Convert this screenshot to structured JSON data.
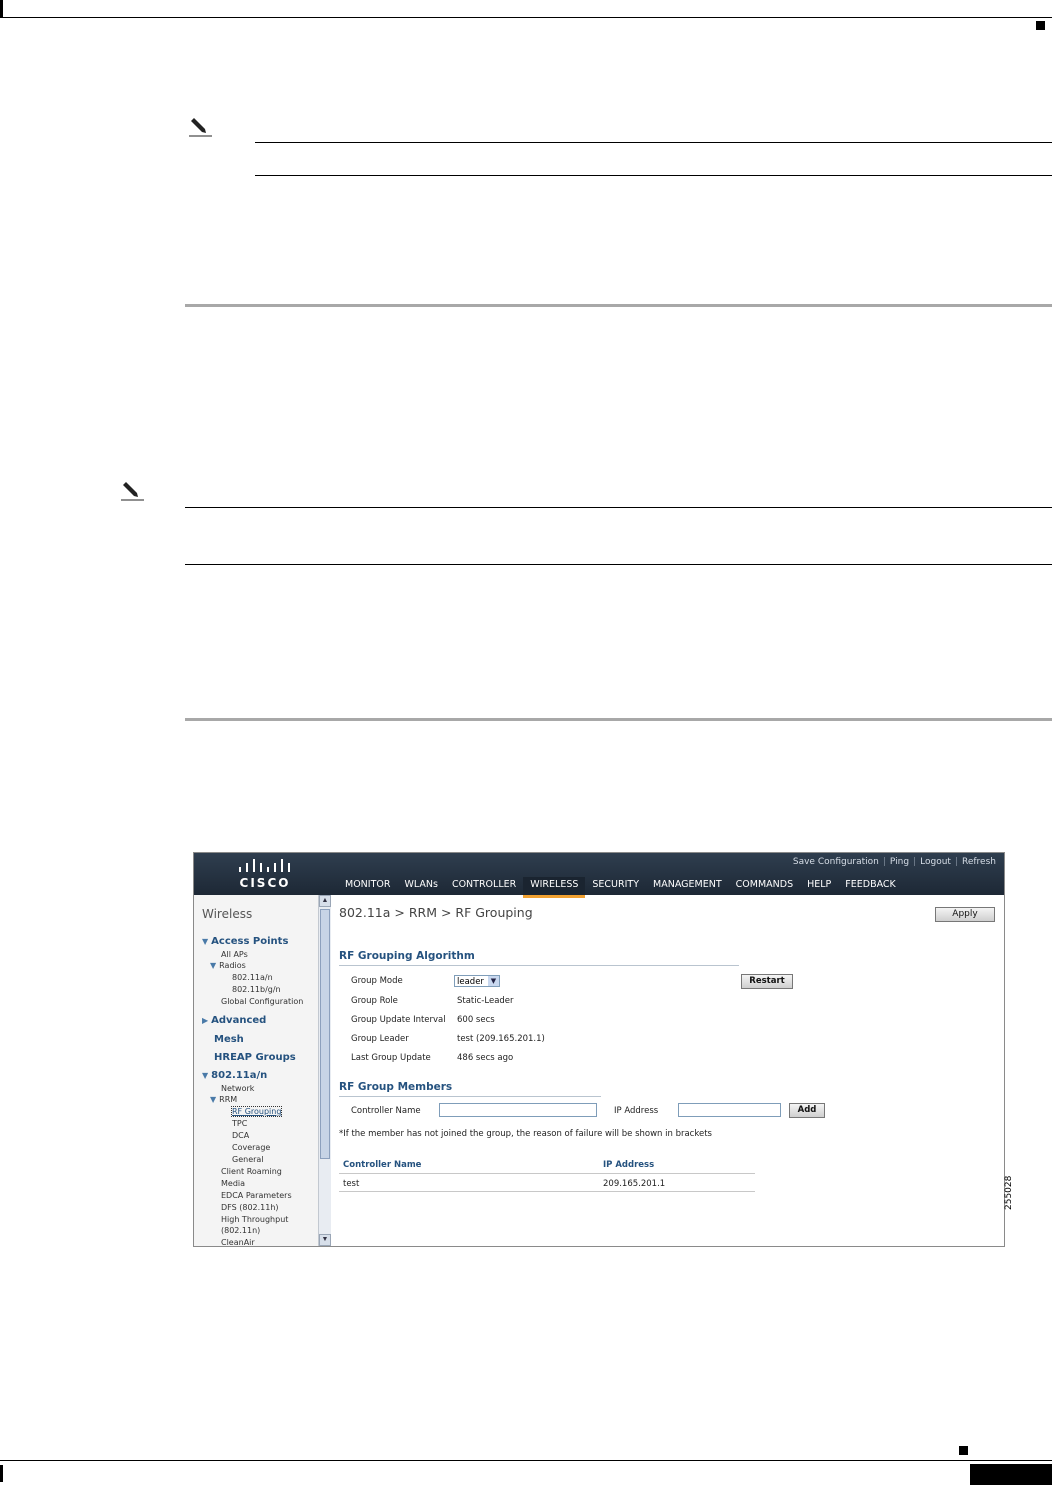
{
  "figure_id": "255028",
  "screenshot": {
    "utility_links": [
      "Save Configuration",
      "Ping",
      "Logout",
      "Refresh"
    ],
    "logo_text": "CISCO",
    "nav": [
      "MONITOR",
      "WLANs",
      "CONTROLLER",
      "WIRELESS",
      "SECURITY",
      "MANAGEMENT",
      "COMMANDS",
      "HELP",
      "FEEDBACK"
    ],
    "active_nav": "WIRELESS",
    "sidebar": {
      "title": "Wireless",
      "access_points": "Access Points",
      "all_aps": "All APs",
      "radios": "Radios",
      "radio_a": "802.11a/n",
      "radio_bg": "802.11b/g/n",
      "global_config": "Global Configuration",
      "advanced": "Advanced",
      "mesh": "Mesh",
      "hreap": "HREAP Groups",
      "band": "802.11a/n",
      "network": "Network",
      "rrm": "RRM",
      "rf_grouping": "RF Grouping",
      "tpc": "TPC",
      "dca": "DCA",
      "coverage": "Coverage",
      "general": "General",
      "client_roaming": "Client Roaming",
      "media": "Media",
      "edca": "EDCA Parameters",
      "dfs": "DFS (802.11h)",
      "high_throughput": "High Throughput",
      "high_throughput_2": "(802.11n)",
      "cleanair": "CleanAir"
    },
    "breadcrumb": "802.11a > RRM > RF Grouping",
    "apply_label": "Apply",
    "algorithm": {
      "title": "RF Grouping Algorithm",
      "group_mode_label": "Group Mode",
      "group_mode_value": "leader",
      "restart_label": "Restart",
      "group_role_label": "Group Role",
      "group_role_value": "Static-Leader",
      "update_interval_label": "Group Update Interval",
      "update_interval_value": "600 secs",
      "group_leader_label": "Group Leader",
      "group_leader_value": "test (209.165.201.1)",
      "last_update_label": "Last Group Update",
      "last_update_value": "486 secs ago"
    },
    "members": {
      "title": "RF Group Members",
      "controller_name_label": "Controller Name",
      "ip_address_label": "IP Address",
      "add_label": "Add",
      "note": "*If the member has not joined the group, the reason of failure will be shown in brackets",
      "col_controller": "Controller Name",
      "col_ip": "IP Address",
      "rows": [
        {
          "name": "test",
          "ip": "209.165.201.1"
        }
      ]
    }
  }
}
